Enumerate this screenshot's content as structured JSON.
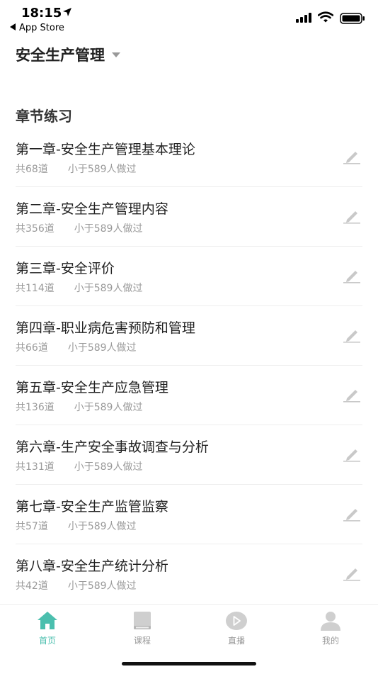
{
  "status_bar": {
    "time": "18:15",
    "back_label": "App Store"
  },
  "header": {
    "title": "安全生产管理"
  },
  "section": {
    "title": "章节练习"
  },
  "chapters": [
    {
      "title": "第一章-安全生产管理基本理论",
      "count": "共68道",
      "done": "小于589人做过"
    },
    {
      "title": "第二章-安全生产管理内容",
      "count": "共356道",
      "done": "小于589人做过"
    },
    {
      "title": "第三章-安全评价",
      "count": "共114道",
      "done": "小于589人做过"
    },
    {
      "title": "第四章-职业病危害预防和管理",
      "count": "共66道",
      "done": "小于589人做过"
    },
    {
      "title": "第五章-安全生产应急管理",
      "count": "共136道",
      "done": "小于589人做过"
    },
    {
      "title": "第六章-生产安全事故调查与分析",
      "count": "共131道",
      "done": "小于589人做过"
    },
    {
      "title": "第七章-安全生产监管监察",
      "count": "共57道",
      "done": "小于589人做过"
    },
    {
      "title": "第八章-安全生产统计分析",
      "count": "共42道",
      "done": "小于589人做过"
    }
  ],
  "tabs": [
    {
      "label": "首页",
      "icon": "home-icon",
      "active": true
    },
    {
      "label": "课程",
      "icon": "book-icon",
      "active": false
    },
    {
      "label": "直播",
      "icon": "play-icon",
      "active": false
    },
    {
      "label": "我的",
      "icon": "user-icon",
      "active": false
    }
  ],
  "colors": {
    "accent": "#4bbfae",
    "inactive": "#999999"
  }
}
